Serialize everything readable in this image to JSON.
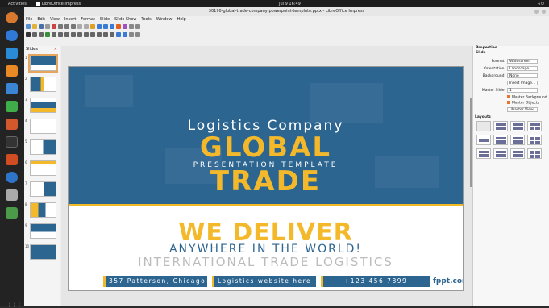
{
  "topbar": {
    "activities": "Activities",
    "app_name": "LibreOffice Impress",
    "clock": "Jul 9  16:49"
  },
  "window": {
    "title": "30190-global-trade-company-powerpoint-template.pptx - LibreOffice Impress"
  },
  "menu": [
    "File",
    "Edit",
    "View",
    "Insert",
    "Format",
    "Slide",
    "Slide Show",
    "Tools",
    "Window",
    "Help"
  ],
  "slides_panel": {
    "title": "Slides",
    "numbers": [
      "1",
      "2",
      "3",
      "4",
      "5",
      "6",
      "7",
      "8",
      "9",
      "10"
    ]
  },
  "slide": {
    "line1": "Logistics Company",
    "line2": "GLOBAL",
    "line3": "PRESENTATION TEMPLATE",
    "line4": "TRADE",
    "line5": "WE DELIVER",
    "line6": "ANYWHERE IN THE WORLD!",
    "line7": "INTERNATIONAL TRADE LOGISTICS",
    "address": "357 Patterson, Chicago",
    "website": "Logistics website here",
    "phone": "+123 456 7899",
    "brand": "fppt.com"
  },
  "properties": {
    "title": "Properties",
    "section": "Slide",
    "format_label": "Format:",
    "format_value": "Widescreen",
    "orientation_label": "Orientation:",
    "orientation_value": "Landscape",
    "background_label": "Background:",
    "background_value": "None",
    "insert_image": "Insert Image...",
    "master_label": "Master Slide:",
    "master_value": "1",
    "master_background": "Master Background",
    "master_objects": "Master Objects",
    "master_view": "Master View",
    "layouts_title": "Layouts"
  },
  "colors": {
    "accent_blue": "#2d6591",
    "accent_yellow": "#f3b92a"
  }
}
